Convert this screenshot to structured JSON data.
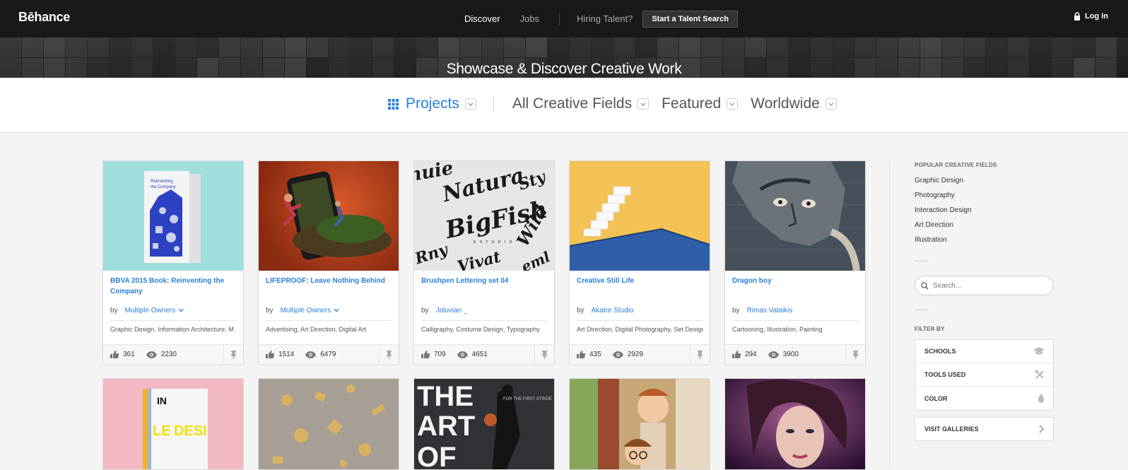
{
  "app": {
    "logo": "Bēhance"
  },
  "nav": {
    "discover": "Discover",
    "jobs": "Jobs",
    "hiring": "Hiring Talent?",
    "cta": "Start a Talent Search",
    "login": "Log In"
  },
  "hero": {
    "title": "Showcase & Discover Creative Work"
  },
  "filters": {
    "projects": "Projects",
    "fields": "All Creative Fields",
    "featured": "Featured",
    "worldwide": "Worldwide"
  },
  "cards": [
    {
      "title": "BBVA 2015 Book: Reinventing the Company",
      "by": "by",
      "owner": "Multiple Owners",
      "fields": "Graphic Design, Information Architecture, M…",
      "likes": "361",
      "views": "2230"
    },
    {
      "title": "LIFEPROOF: Leave Nothing Behind",
      "by": "by",
      "owner": "Multiple Owners",
      "fields": "Advertising, Art Direction, Digital Art",
      "likes": "1514",
      "views": "6479"
    },
    {
      "title": "Brushpen Lettering set 04",
      "by": "by",
      "owner": "Joluvian _",
      "fields": "Calligraphy, Costume Design, Typography",
      "likes": "709",
      "views": "4651"
    },
    {
      "title": "Creative Still Life",
      "by": "by",
      "owner": "Akatre Studio",
      "fields": "Art Direction, Digital Photography, Set Design",
      "likes": "435",
      "views": "2929"
    },
    {
      "title": "Dragon boy",
      "by": "by",
      "owner": "Rimas Valaikis",
      "fields": "Cartooning, Illustration, Painting",
      "likes": "294",
      "views": "3900"
    }
  ],
  "sidebar": {
    "popular_heading": "POPULAR CREATIVE FIELDS",
    "popular": [
      "Graphic Design",
      "Photography",
      "Interaction Design",
      "Art Direction",
      "Illustration"
    ],
    "search_placeholder": "Search...",
    "filter_heading": "FILTER BY",
    "filter_rows": [
      "SCHOOLS",
      "TOOLS USED",
      "COLOR"
    ],
    "visit": "VISIT GALLERIES"
  },
  "colors": {
    "accent": "#2b7fd8",
    "topbar": "#191919"
  }
}
